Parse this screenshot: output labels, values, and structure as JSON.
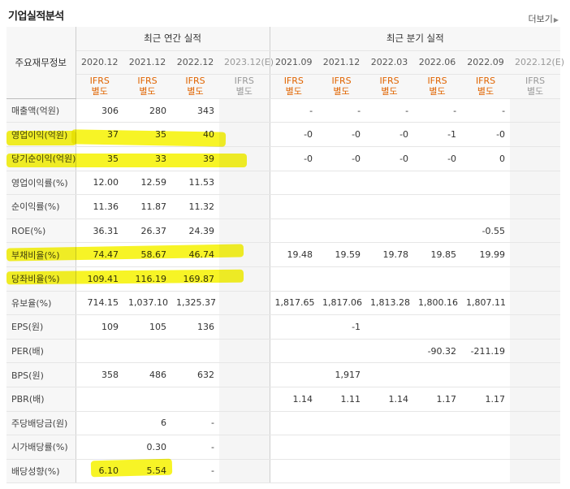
{
  "title": "기업실적분석",
  "more_label": "더보기",
  "header": {
    "label_col": "주요재무정보",
    "annual_group": "최근 연간 실적",
    "quarter_group": "최근 분기 실적",
    "annual_periods": [
      "2020.12",
      "2021.12",
      "2022.12",
      "2023.12(E)"
    ],
    "quarter_periods": [
      "2021.09",
      "2021.12",
      "2022.03",
      "2022.06",
      "2022.09",
      "2022.12(E)"
    ],
    "basis_line1": "IFRS",
    "basis_line2": "별도"
  },
  "rows": [
    {
      "label": "매출액(억원)",
      "annual": [
        "306",
        "280",
        "343",
        ""
      ],
      "quarter": [
        "-",
        "-",
        "-",
        "-",
        "-",
        ""
      ]
    },
    {
      "label": "영업이익(억원)",
      "annual": [
        "37",
        "35",
        "40",
        ""
      ],
      "quarter": [
        "-0",
        "-0",
        "-0",
        "-1",
        "-0",
        ""
      ]
    },
    {
      "label": "당기순이익(억원)",
      "annual": [
        "35",
        "33",
        "39",
        ""
      ],
      "quarter": [
        "-0",
        "-0",
        "-0",
        "-0",
        "0",
        ""
      ]
    },
    {
      "label": "영업이익률(%)",
      "annual": [
        "12.00",
        "12.59",
        "11.53",
        ""
      ],
      "quarter": [
        "",
        "",
        "",
        "",
        "",
        ""
      ]
    },
    {
      "label": "순이익률(%)",
      "annual": [
        "11.36",
        "11.87",
        "11.32",
        ""
      ],
      "quarter": [
        "",
        "",
        "",
        "",
        "",
        ""
      ]
    },
    {
      "label": "ROE(%)",
      "annual": [
        "36.31",
        "26.37",
        "24.39",
        ""
      ],
      "quarter": [
        "",
        "",
        "",
        "",
        "-0.55",
        ""
      ]
    },
    {
      "label": "부채비율(%)",
      "annual": [
        "74.47",
        "58.67",
        "46.74",
        ""
      ],
      "quarter": [
        "19.48",
        "19.59",
        "19.78",
        "19.85",
        "19.99",
        ""
      ]
    },
    {
      "label": "당좌비율(%)",
      "annual": [
        "109.41",
        "116.19",
        "169.87",
        ""
      ],
      "quarter": [
        "",
        "",
        "",
        "",
        "",
        ""
      ]
    },
    {
      "label": "유보율(%)",
      "annual": [
        "714.15",
        "1,037.10",
        "1,325.37",
        ""
      ],
      "quarter": [
        "1,817.65",
        "1,817.06",
        "1,813.28",
        "1,800.16",
        "1,807.11",
        ""
      ]
    },
    {
      "label": "EPS(원)",
      "annual": [
        "109",
        "105",
        "136",
        ""
      ],
      "quarter": [
        "",
        "-1",
        "",
        "",
        "",
        ""
      ]
    },
    {
      "label": "PER(배)",
      "annual": [
        "",
        "",
        "",
        ""
      ],
      "quarter": [
        "",
        "",
        "",
        "-90.32",
        "-211.19",
        ""
      ]
    },
    {
      "label": "BPS(원)",
      "annual": [
        "358",
        "486",
        "632",
        ""
      ],
      "quarter": [
        "",
        "1,917",
        "",
        "",
        "",
        ""
      ]
    },
    {
      "label": "PBR(배)",
      "annual": [
        "",
        "",
        "",
        ""
      ],
      "quarter": [
        "1.14",
        "1.11",
        "1.14",
        "1.17",
        "1.17",
        ""
      ]
    },
    {
      "label": "주당배당금(원)",
      "annual": [
        "",
        "6",
        "-",
        ""
      ],
      "quarter": [
        "",
        "",
        "",
        "",
        "",
        ""
      ]
    },
    {
      "label": "시가배당률(%)",
      "annual": [
        "",
        "0.30",
        "-",
        ""
      ],
      "quarter": [
        "",
        "",
        "",
        "",
        "",
        ""
      ]
    },
    {
      "label": "배당성향(%)",
      "annual": [
        "6.10",
        "5.54",
        "-",
        ""
      ],
      "quarter": [
        "",
        "",
        "",
        "",
        "",
        ""
      ]
    }
  ],
  "colors": {
    "negative": "#e4252a",
    "basis": "#e06400",
    "highlight": "#f6f300"
  }
}
